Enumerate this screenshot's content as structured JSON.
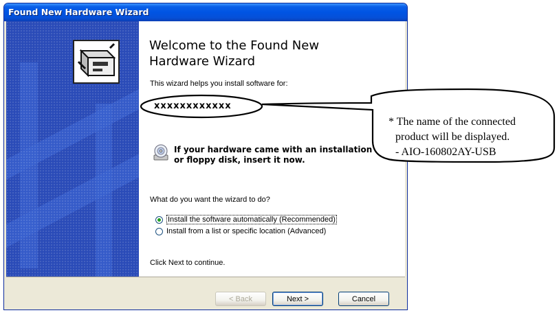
{
  "window": {
    "title": "Found New Hardware Wizard"
  },
  "wizard": {
    "heading": "Welcome to the Found New Hardware Wizard",
    "helps_text": "This wizard helps you install software for:",
    "device_name": "xxxxxxxxxxxx",
    "cd_prompt_line1": "If your hardware came with an installation CD",
    "cd_prompt_line2": "or floppy disk, insert it now.",
    "question": "What do you want the wizard to do?",
    "options": [
      {
        "label": "Install the software automatically (Recommended)",
        "selected": true
      },
      {
        "label": "Install from a list or specific location (Advanced)",
        "selected": false
      }
    ],
    "continue_text": "Click Next to continue."
  },
  "buttons": {
    "back": "< Back",
    "next": "Next >",
    "cancel": "Cancel"
  },
  "annotation": {
    "line1": "* The name of the connected",
    "line2": "product will be displayed.",
    "line3": "- AIO-160802AY-USB"
  },
  "icons": {
    "wizard": "hardware-wizard-icon",
    "cd": "cd-disk-icon"
  }
}
